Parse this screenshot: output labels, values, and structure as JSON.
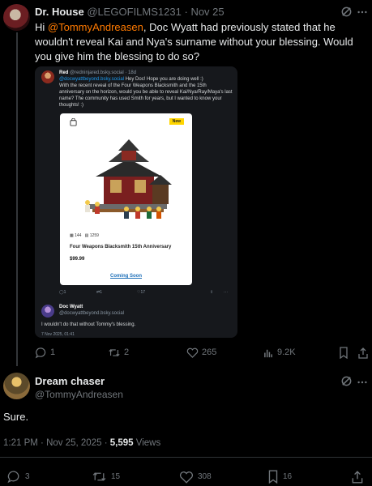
{
  "parent_tweet": {
    "author_name": "Dr. House",
    "author_handle": "@LEGOFILMS1231",
    "separator": "·",
    "date": "Nov 25",
    "text_before": "Hi ",
    "mention": "@TommyAndreasen",
    "text_after": ", Doc Wyatt had previously stated that he wouldn't reveal Kai and Nya's surname without your blessing. Would you give him the blessing to do so?",
    "actions": {
      "replies": "1",
      "reposts": "2",
      "likes": "265",
      "views": "9.2K"
    }
  },
  "embedded_screenshot": {
    "reply_author": "Red",
    "reply_handle": "@redninjared.bsky.social · 18d",
    "reply_mention": "@docwyattbeyond.bsky.social",
    "reply_body_head": "Hey Doc! Hope you are doing well :)",
    "reply_body": "With the recent reveal of the Four Weapons Blacksmith and the 15th anniversary on the horizon, would you be able to reveal Kai/Nya/Ray/Maya's last name? The community has used Smith for years, but I wanted to know your thoughts! :)",
    "product_card": {
      "badge": "New",
      "pieces": "144",
      "set_number": "1259",
      "title": "Four Weapons Blacksmith 15th Anniversary",
      "price": "$99.99",
      "cta": "Coming Soon"
    },
    "mini_actions": {
      "replies": "1",
      "reposts": "1",
      "likes": "17"
    },
    "second_author": "Doc Wyatt",
    "second_handle": "@docwyattbeyond.bsky.social",
    "second_text": "I wouldn't do that without Tommy's blessing.",
    "second_date_partial": "7 Nov 2025, 01:41"
  },
  "main_tweet": {
    "author_name": "Dream chaser",
    "author_handle": "@TommyAndreasen",
    "text": "Sure.",
    "time": "1:21 PM",
    "separator": "·",
    "date": "Nov 25, 2025",
    "views_count": "5,595",
    "views_label": "Views",
    "actions": {
      "replies": "3",
      "reposts": "15",
      "likes": "308",
      "bookmarks": "16"
    }
  },
  "icons": [
    "grok-icon",
    "more-dots-icon",
    "reply-icon",
    "repost-icon",
    "like-icon",
    "views-icon",
    "bookmark-icon",
    "share-icon"
  ],
  "colors": {
    "background": "#000000",
    "text": "#e7e9ea",
    "muted": "#71767b",
    "mention": "#ff7a00",
    "divider": "#2f3336"
  }
}
